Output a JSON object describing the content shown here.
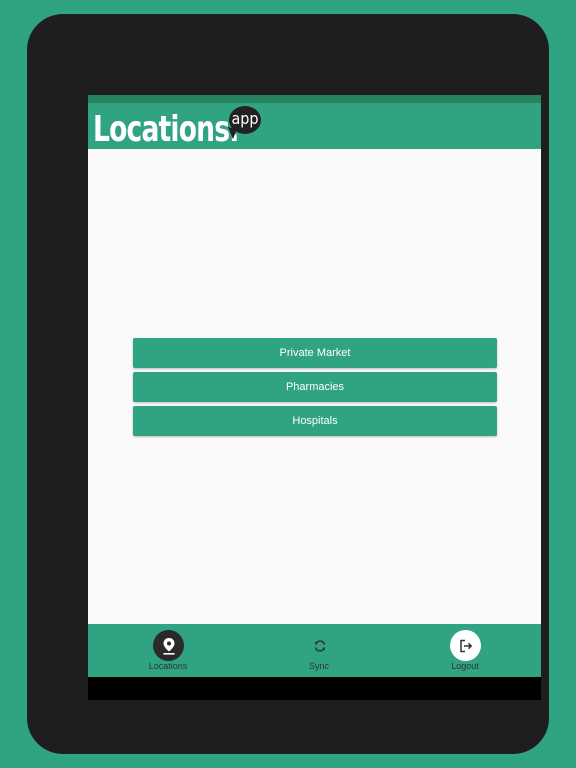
{
  "app": {
    "logo_main": "Locations.",
    "logo_badge": "app"
  },
  "menu": {
    "items": [
      {
        "label": "Private Market"
      },
      {
        "label": "Pharmacies"
      },
      {
        "label": "Hospitals"
      }
    ]
  },
  "bottom_nav": {
    "items": [
      {
        "label": "Locations",
        "icon": "location-pin-icon",
        "active": true
      },
      {
        "label": "Sync",
        "icon": "sync-icon",
        "active": false
      },
      {
        "label": "Logout",
        "icon": "logout-icon",
        "active": false
      }
    ]
  },
  "colors": {
    "primary": "#2fa382",
    "status_bar": "#27825f",
    "content_bg": "#fafafa",
    "device_frame": "#1e1e1e"
  }
}
